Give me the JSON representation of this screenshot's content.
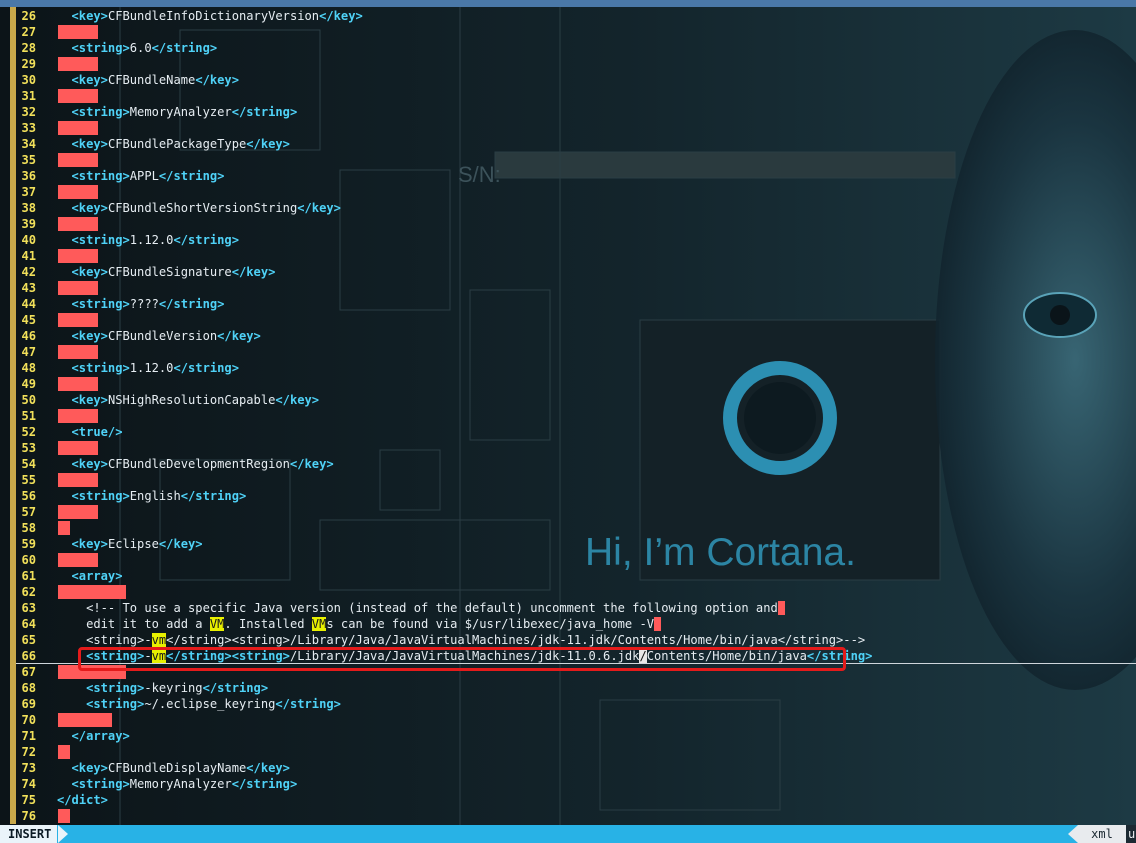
{
  "editor": {
    "mode": "INSERT",
    "filetype": "xml",
    "encoding": "u",
    "background_caption": "Hi, I'm Cortana.",
    "lines": [
      {
        "n": "26",
        "indent": 2,
        "parts": [
          [
            "tag",
            "<key>"
          ],
          [
            "txt",
            "CFBundleInfoDictionaryVersion"
          ],
          [
            "tag",
            "</key>"
          ]
        ]
      },
      {
        "n": "27",
        "ws": 40
      },
      {
        "n": "28",
        "indent": 2,
        "parts": [
          [
            "tag",
            "<string>"
          ],
          [
            "txt",
            "6.0"
          ],
          [
            "tag",
            "</string>"
          ]
        ]
      },
      {
        "n": "29",
        "ws": 40
      },
      {
        "n": "30",
        "indent": 2,
        "parts": [
          [
            "tag",
            "<key>"
          ],
          [
            "txt",
            "CFBundleName"
          ],
          [
            "tag",
            "</key>"
          ]
        ]
      },
      {
        "n": "31",
        "ws": 40
      },
      {
        "n": "32",
        "indent": 2,
        "parts": [
          [
            "tag",
            "<string>"
          ],
          [
            "txt",
            "MemoryAnalyzer"
          ],
          [
            "tag",
            "</string>"
          ]
        ]
      },
      {
        "n": "33",
        "ws": 40
      },
      {
        "n": "34",
        "indent": 2,
        "parts": [
          [
            "tag",
            "<key>"
          ],
          [
            "txt",
            "CFBundlePackageType"
          ],
          [
            "tag",
            "</key>"
          ]
        ]
      },
      {
        "n": "35",
        "ws": 40
      },
      {
        "n": "36",
        "indent": 2,
        "parts": [
          [
            "tag",
            "<string>"
          ],
          [
            "txt",
            "APPL"
          ],
          [
            "tag",
            "</string>"
          ]
        ]
      },
      {
        "n": "37",
        "ws": 40
      },
      {
        "n": "38",
        "indent": 2,
        "parts": [
          [
            "tag",
            "<key>"
          ],
          [
            "txt",
            "CFBundleShortVersionString"
          ],
          [
            "tag",
            "</key>"
          ]
        ]
      },
      {
        "n": "39",
        "ws": 40
      },
      {
        "n": "40",
        "indent": 2,
        "parts": [
          [
            "tag",
            "<string>"
          ],
          [
            "txt",
            "1.12.0"
          ],
          [
            "tag",
            "</string>"
          ]
        ]
      },
      {
        "n": "41",
        "ws": 40
      },
      {
        "n": "42",
        "indent": 2,
        "parts": [
          [
            "tag",
            "<key>"
          ],
          [
            "txt",
            "CFBundleSignature"
          ],
          [
            "tag",
            "</key>"
          ]
        ]
      },
      {
        "n": "43",
        "ws": 40
      },
      {
        "n": "44",
        "indent": 2,
        "parts": [
          [
            "tag",
            "<string>"
          ],
          [
            "txt",
            "????"
          ],
          [
            "tag",
            "</string>"
          ]
        ]
      },
      {
        "n": "45",
        "ws": 40
      },
      {
        "n": "46",
        "indent": 2,
        "parts": [
          [
            "tag",
            "<key>"
          ],
          [
            "txt",
            "CFBundleVersion"
          ],
          [
            "tag",
            "</key>"
          ]
        ]
      },
      {
        "n": "47",
        "ws": 40
      },
      {
        "n": "48",
        "indent": 2,
        "parts": [
          [
            "tag",
            "<string>"
          ],
          [
            "txt",
            "1.12.0"
          ],
          [
            "tag",
            "</string>"
          ]
        ]
      },
      {
        "n": "49",
        "ws": 40
      },
      {
        "n": "50",
        "indent": 2,
        "parts": [
          [
            "tag",
            "<key>"
          ],
          [
            "txt",
            "NSHighResolutionCapable"
          ],
          [
            "tag",
            "</key>"
          ]
        ]
      },
      {
        "n": "51",
        "ws": 40
      },
      {
        "n": "52",
        "indent": 2,
        "parts": [
          [
            "tag",
            "<true/>"
          ]
        ]
      },
      {
        "n": "53",
        "ws": 40
      },
      {
        "n": "54",
        "indent": 2,
        "parts": [
          [
            "tag",
            "<key>"
          ],
          [
            "txt",
            "CFBundleDevelopmentRegion"
          ],
          [
            "tag",
            "</key>"
          ]
        ]
      },
      {
        "n": "55",
        "ws": 40
      },
      {
        "n": "56",
        "indent": 2,
        "parts": [
          [
            "tag",
            "<string>"
          ],
          [
            "txt",
            "English"
          ],
          [
            "tag",
            "</string>"
          ]
        ]
      },
      {
        "n": "57",
        "ws": 40
      },
      {
        "n": "58",
        "ws": 12
      },
      {
        "n": "59",
        "indent": 2,
        "parts": [
          [
            "tag",
            "<key>"
          ],
          [
            "txt",
            "Eclipse"
          ],
          [
            "tag",
            "</key>"
          ]
        ]
      },
      {
        "n": "60",
        "ws": 40
      },
      {
        "n": "61",
        "indent": 2,
        "parts": [
          [
            "tag",
            "<array>"
          ]
        ]
      },
      {
        "n": "62",
        "ws": 68
      },
      {
        "n": "63",
        "indent": 4,
        "parts": [
          [
            "cmt",
            "<!-- To use a specific Java version (instead of the default) uncomment the following option and"
          ]
        ],
        "eol": true
      },
      {
        "n": "64",
        "indent": 4,
        "parts": [
          [
            "cmt",
            "edit it to add a "
          ],
          [
            "hl",
            "VM"
          ],
          [
            "cmt",
            ". Installed "
          ],
          [
            "hl",
            "VM"
          ],
          [
            "cmt",
            "s can be found via $/usr/libexec/java_home -V"
          ]
        ],
        "eol": true
      },
      {
        "n": "65",
        "indent": 4,
        "parts": [
          [
            "cmt",
            "<string>-"
          ],
          [
            "hl",
            "vm"
          ],
          [
            "cmt",
            "</string><string>/Library/Java/JavaVirtualMachines/jdk-11.jdk/Contents/Home/bin/java</string>-->"
          ]
        ]
      },
      {
        "n": "66",
        "indent": 4,
        "parts": [
          [
            "tag",
            "<string>"
          ],
          [
            "txt",
            "-"
          ],
          [
            "hl",
            "vm"
          ],
          [
            "tag",
            "</string><string>"
          ],
          [
            "txt",
            "/Library/Java/JavaVirtualMachines/jdk-11.0.6.jdk"
          ],
          [
            "cur",
            "/"
          ],
          [
            "txt",
            "Contents/Home/bin/java"
          ],
          [
            "tag",
            "</string>"
          ]
        ]
      },
      {
        "n": "67",
        "ws": 68
      },
      {
        "n": "68",
        "indent": 4,
        "parts": [
          [
            "tag",
            "<string>"
          ],
          [
            "txt",
            "-keyring"
          ],
          [
            "tag",
            "</string>"
          ]
        ]
      },
      {
        "n": "69",
        "indent": 4,
        "parts": [
          [
            "tag",
            "<string>"
          ],
          [
            "txt",
            "~/.eclipse_keyring"
          ],
          [
            "tag",
            "</string>"
          ]
        ]
      },
      {
        "n": "70",
        "ws": 54
      },
      {
        "n": "71",
        "indent": 2,
        "parts": [
          [
            "tag",
            "</array>"
          ]
        ]
      },
      {
        "n": "72",
        "ws": 12
      },
      {
        "n": "73",
        "indent": 2,
        "parts": [
          [
            "tag",
            "<key>"
          ],
          [
            "txt",
            "CFBundleDisplayName"
          ],
          [
            "tag",
            "</key>"
          ]
        ]
      },
      {
        "n": "74",
        "indent": 2,
        "parts": [
          [
            "tag",
            "<string>"
          ],
          [
            "txt",
            "MemoryAnalyzer"
          ],
          [
            "tag",
            "</string>"
          ]
        ]
      },
      {
        "n": "75",
        "indent": 0,
        "parts": [
          [
            "tag",
            "</dict>"
          ]
        ]
      },
      {
        "n": "76",
        "ws": 12
      }
    ]
  },
  "colors": {
    "tag": "#4fd2f7",
    "line_number": "#f1e05a",
    "trailing_whitespace": "#ff5a5a",
    "search_highlight": "#e8f000",
    "statusline": "#28b2e6",
    "annotation_box": "#e41b1b"
  }
}
